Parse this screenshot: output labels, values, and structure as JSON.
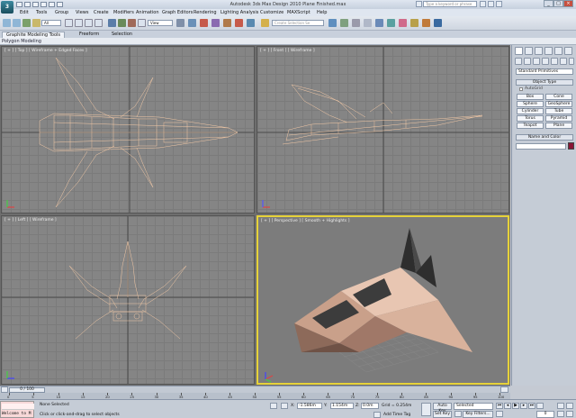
{
  "app": {
    "window_title": "Autodesk 3ds Max Design 2010     Plane Finished.max",
    "logo_text": "3",
    "search_placeholder": "Type a keyword or phrase"
  },
  "menubar": [
    "Edit",
    "Tools",
    "Group",
    "Views",
    "Create",
    "Modifiers",
    "Animation",
    "Graph Editors",
    "Rendering",
    "Lighting Analysis",
    "Customize",
    "MAXScript",
    "Help"
  ],
  "toolbar": {
    "filter_value": "All",
    "refcoord_value": "View",
    "selection_set_placeholder": "Create Selection Se"
  },
  "ribbon": {
    "tabs": [
      "Graphite Modeling Tools",
      "Freeform",
      "Selection"
    ],
    "sub_label": "Polygon Modeling"
  },
  "viewports": {
    "top_label": "[ + ] [ Top ] [ Wireframe + Edged Faces ]",
    "front_label": "[ + ] [ Front ] [ Wireframe ]",
    "left_label": "[ + ] [ Left ] [ Wireframe ]",
    "perspective_label": "[ + ] [ Perspective ] [ Smooth + Highlights ]",
    "wire_color": "#f3c9a6",
    "active_border_color": "#e6d23a"
  },
  "command_panel": {
    "category_value": "Standard Primitives",
    "object_type_title": "Object Type",
    "autogrid_label": "AutoGrid",
    "buttons": [
      "Box",
      "Cone",
      "Sphere",
      "GeoSphere",
      "Cylinder",
      "Tube",
      "Torus",
      "Pyramid",
      "Teapot",
      "Plane"
    ],
    "name_color_title": "Name and Color",
    "object_color": "#8a1535"
  },
  "timeline": {
    "slider_text": "0 / 100",
    "ticks": [
      "0",
      "5",
      "10",
      "15",
      "20",
      "25",
      "30",
      "35",
      "40",
      "45",
      "50",
      "55",
      "60",
      "65",
      "70",
      "75",
      "80",
      "85",
      "90",
      "95",
      "100"
    ]
  },
  "status": {
    "maxscript_text": "Welcome to M",
    "selection_text": "None Selected",
    "prompt_text": "Click or click-and-drag to select objects",
    "x_label": "X:",
    "x_value": "-1.586m",
    "y_label": "Y:",
    "y_value": "1.154m",
    "z_label": "Z:",
    "z_value": "0.0m",
    "grid_text": "Grid = 0.254m",
    "add_time_tag": "Add Time Tag",
    "auto_key": "Auto Key",
    "set_key": "Set Key",
    "selected_dropdown": "Selected",
    "key_filters": "Key Filters...",
    "current_frame": "0"
  }
}
